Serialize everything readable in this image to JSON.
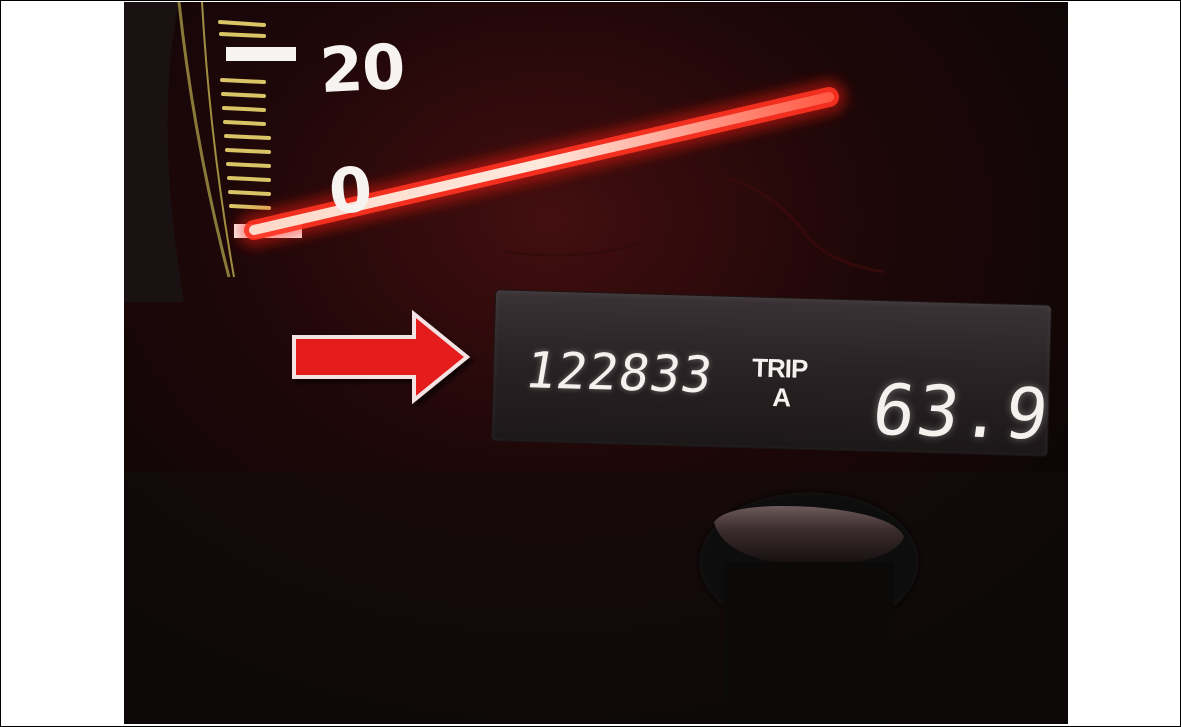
{
  "speedometer": {
    "label_top": "20",
    "label_bottom": "0"
  },
  "odometer_display": {
    "odometer_reading": "122833",
    "trip_word": "TRIP",
    "trip_letter": "A",
    "trip_reading": "63.9"
  },
  "arrow_annotation": {
    "color": "#e41d1d",
    "direction": "right"
  },
  "colors": {
    "needle": "#ff2a1f",
    "gauge_ring": "#c9b44a",
    "display_text": "#f4f1ee",
    "frame_border": "#000000"
  }
}
